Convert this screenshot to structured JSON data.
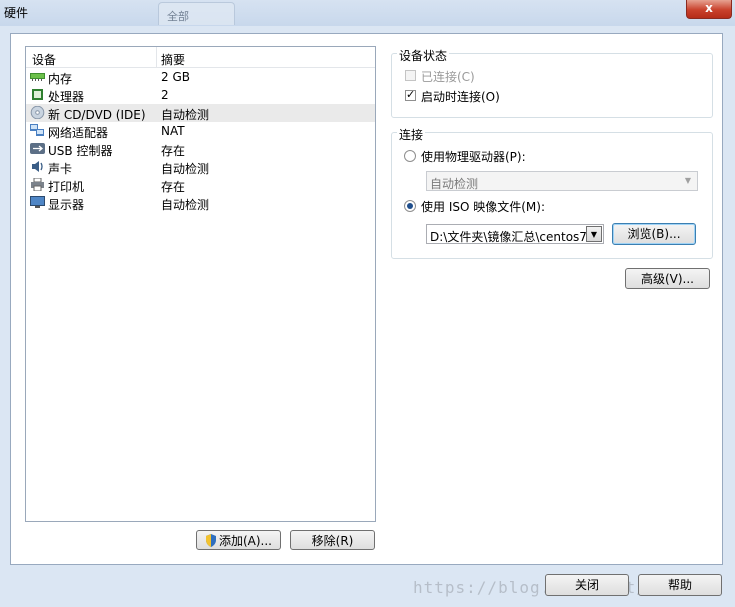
{
  "window": {
    "title": "硬件",
    "bg_tab": "全部",
    "close_glyph": "x"
  },
  "device_list": {
    "col_device": "设备",
    "col_summary": "摘要",
    "rows": [
      {
        "name": "内存",
        "value": "2 GB",
        "icon": "memory-icon"
      },
      {
        "name": "处理器",
        "value": "2",
        "icon": "processor-icon"
      },
      {
        "name": "新 CD/DVD (IDE)",
        "value": "自动检测",
        "icon": "cd-dvd-icon",
        "selected": true
      },
      {
        "name": "网络适配器",
        "value": "NAT",
        "icon": "network-adapter-icon"
      },
      {
        "name": "USB 控制器",
        "value": "存在",
        "icon": "usb-icon"
      },
      {
        "name": "声卡",
        "value": "自动检测",
        "icon": "sound-card-icon"
      },
      {
        "name": "打印机",
        "value": "存在",
        "icon": "printer-icon"
      },
      {
        "name": "显示器",
        "value": "自动检测",
        "icon": "display-icon"
      }
    ],
    "add_label": "添加(A)...",
    "remove_label": "移除(R)"
  },
  "device_status": {
    "title": "设备状态",
    "connected_label": "已连接(C)",
    "connected_checked": false,
    "connect_on_poweron_label": "启动时连接(O)",
    "connect_on_poweron_checked": true
  },
  "connection": {
    "title": "连接",
    "physical_label": "使用物理驱动器(P):",
    "physical_selected": false,
    "physical_value": "自动检测",
    "iso_label": "使用 ISO 映像文件(M):",
    "iso_selected": true,
    "iso_path": "D:\\文件夹\\镜像汇总\\centos7",
    "browse_label": "浏览(B)..."
  },
  "advanced_label": "高级(V)...",
  "footer": {
    "close_label": "关闭",
    "help_label": "帮助",
    "watermark": "https://blog.csdn.net/..."
  }
}
